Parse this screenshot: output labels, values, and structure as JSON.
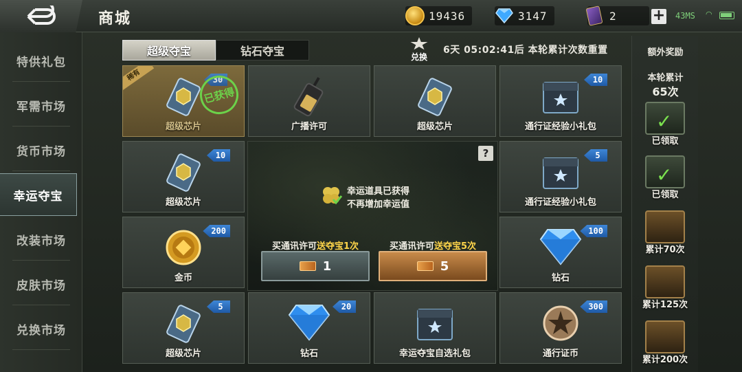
{
  "header": {
    "title": "商城",
    "gold": "19436",
    "diamond": "3147",
    "cards": "2",
    "net": "43MS"
  },
  "sidebar": {
    "items": [
      {
        "label": "特供礼包"
      },
      {
        "label": "军需市场"
      },
      {
        "label": "货币市场"
      },
      {
        "label": "幸运夺宝"
      },
      {
        "label": "改装市场"
      },
      {
        "label": "皮肤市场"
      },
      {
        "label": "兑换市场"
      }
    ]
  },
  "tabs": {
    "active": "超级夺宝",
    "other": "钻石夺宝"
  },
  "exchange_label": "兑换",
  "timer": "6天 05:02:41后 本轮累计次数重置",
  "grid": {
    "c0": {
      "name": "超级芯片",
      "qty": "30",
      "tag": "稀有",
      "stamp": "已获得"
    },
    "c1": {
      "name": "广播许可"
    },
    "c2": {
      "name": "超级芯片"
    },
    "c3": {
      "name": "通行证经验小礼包",
      "qty": "10"
    },
    "c4": {
      "name": "超级芯片",
      "qty": "10"
    },
    "c5": {
      "name": "通行证经验小礼包",
      "qty": "5"
    },
    "c6": {
      "name": "金币",
      "qty": "200"
    },
    "c7": {
      "name": "钻石",
      "qty": "100"
    },
    "c8": {
      "name": "超级芯片",
      "qty": "5"
    },
    "c9": {
      "name": "钻石",
      "qty": "20"
    },
    "c10": {
      "name": "幸运夺宝自选礼包"
    },
    "c11": {
      "name": "通行证币",
      "qty": "300"
    }
  },
  "center": {
    "luck_line1": "幸运道具已获得",
    "luck_line2": "不再增加幸运值",
    "help": "?",
    "buy1": {
      "prefix": "买通讯许可",
      "highlight": "送夺宝1次",
      "count": "1"
    },
    "buy5": {
      "prefix": "买通讯许可",
      "highlight": "送夺宝5次",
      "count": "5"
    }
  },
  "right": {
    "title": "额外奖励",
    "round_label": "本轮累计",
    "round_count": "65次",
    "rewards": [
      {
        "label": "已领取",
        "claimed": true
      },
      {
        "label": "已领取",
        "claimed": true
      },
      {
        "label": "累计70次",
        "claimed": false
      },
      {
        "label": "累计125次",
        "claimed": false
      },
      {
        "label": "累计200次",
        "claimed": false
      }
    ]
  },
  "colors": {
    "qty_badge": "#2a6fc4",
    "check": "#6cd24a",
    "highlight": "#ffd54a"
  }
}
